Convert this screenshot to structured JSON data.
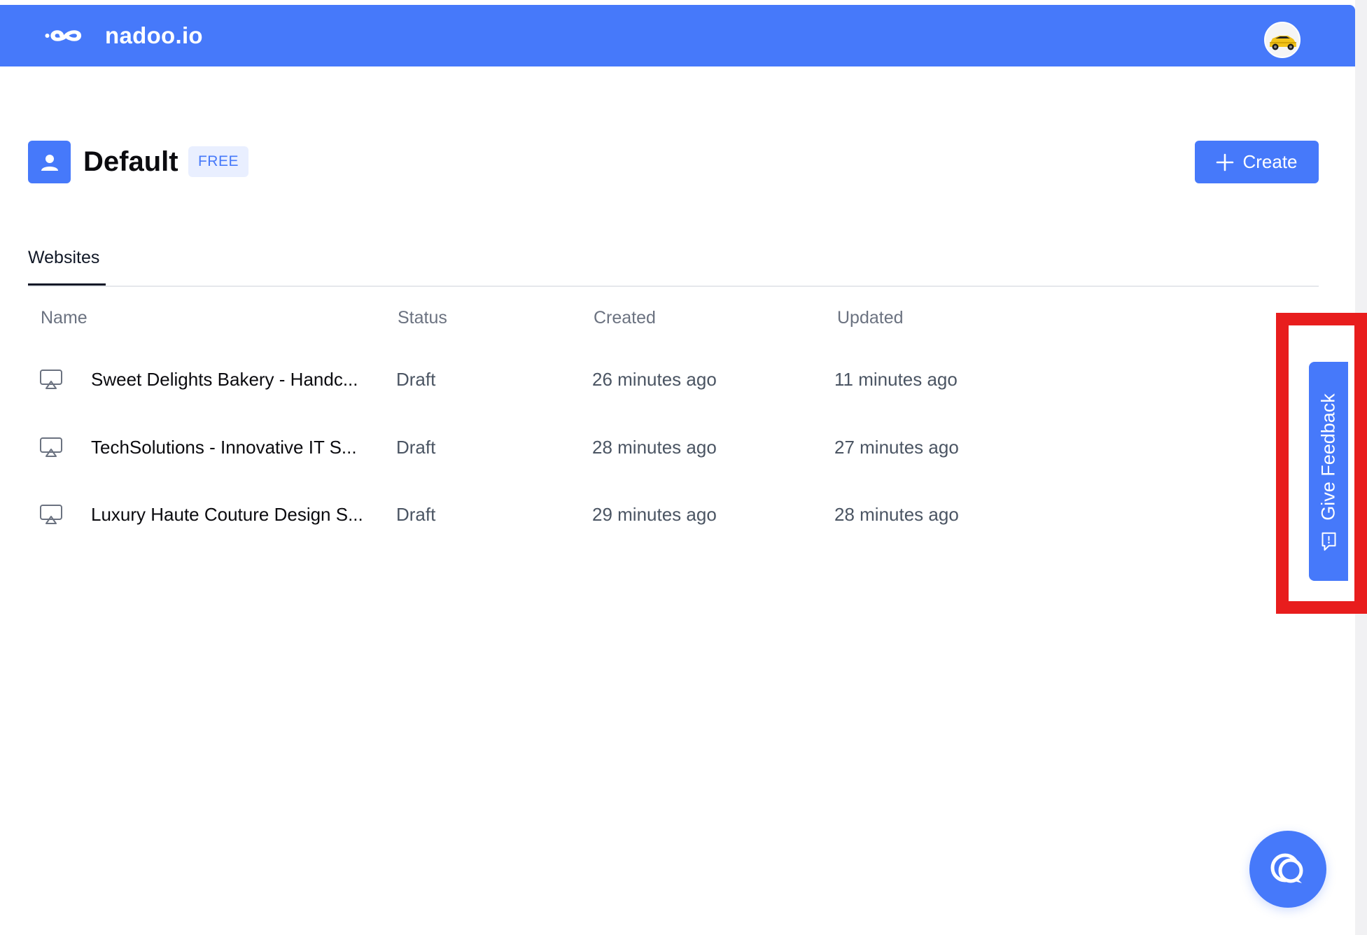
{
  "colors": {
    "brand": "#4679fa",
    "highlight": "#e81d1d",
    "badge_bg": "#e9efff"
  },
  "header": {
    "brand_name": "nadoo.io",
    "logo_icon": "infinity-logo-icon",
    "avatar_icon": "user-avatar"
  },
  "workspace": {
    "icon": "user-icon",
    "title": "Default",
    "plan_badge": "FREE"
  },
  "toolbar": {
    "create_label": "Create",
    "create_icon": "plus-icon"
  },
  "tabs": [
    {
      "label": "Websites",
      "active": true
    }
  ],
  "table": {
    "columns": [
      "Name",
      "Status",
      "Created",
      "Updated"
    ],
    "rows": [
      {
        "name": "Sweet Delights Bakery - Handc...",
        "status": "Draft",
        "created": "26 minutes ago",
        "updated": "11 minutes ago"
      },
      {
        "name": "TechSolutions - Innovative IT S...",
        "status": "Draft",
        "created": "28 minutes ago",
        "updated": "27 minutes ago"
      },
      {
        "name": "Luxury Haute Couture Design S...",
        "status": "Draft",
        "created": "29 minutes ago",
        "updated": "28 minutes ago"
      }
    ],
    "row_icon": "website-preview-icon"
  },
  "feedback": {
    "label": "Give Feedback",
    "icon": "feedback-icon"
  },
  "chat": {
    "icon": "chat-bubble-icon"
  }
}
